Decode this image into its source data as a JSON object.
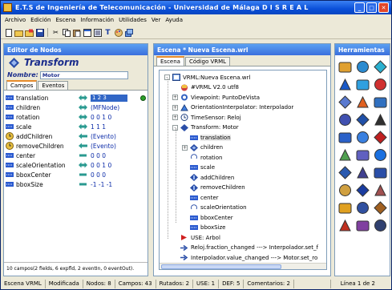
{
  "window": {
    "title": "E.T.S de Ingeniería de Telecomunicación - Universidad de Málaga    D I S R E A L"
  },
  "menu": [
    "Archivo",
    "Edición",
    "Escena",
    "Información",
    "Utilidades",
    "Ver",
    "Ayuda"
  ],
  "left_panel": {
    "header": "Editor de Nodos",
    "node_type": "Transform",
    "nombre_label": "Nombre:",
    "nombre_value": "Motor",
    "tabs": [
      "Campos",
      "Eventos"
    ],
    "fields": [
      {
        "name": "translation",
        "value": "1 2 3",
        "kind": "exposed",
        "selected": true
      },
      {
        "name": "children",
        "value": "(MFNode)",
        "kind": "exposed"
      },
      {
        "name": "rotation",
        "value": "0 0 1 0",
        "kind": "exposed"
      },
      {
        "name": "scale",
        "value": "1 1 1",
        "kind": "exposed"
      },
      {
        "name": "addChildren",
        "value": "(Evento)",
        "kind": "eventIn"
      },
      {
        "name": "removeChildren",
        "value": "(Evento)",
        "kind": "eventIn"
      },
      {
        "name": "center",
        "value": "0 0 0",
        "kind": "field"
      },
      {
        "name": "scaleOrientation",
        "value": "0 0 1 0",
        "kind": "exposed"
      },
      {
        "name": "bboxCenter",
        "value": "0 0 0",
        "kind": "field"
      },
      {
        "name": "bboxSize",
        "value": "-1 -1 -1",
        "kind": "field"
      }
    ],
    "status": "10 campos(2 fields, 6 expfld, 2 eventIn, 0 eventOut)."
  },
  "mid_panel": {
    "header": "Escena * Nueva Escena.wrl",
    "tabs": [
      "Escena",
      "Código VRML"
    ],
    "tree": [
      {
        "label": "VRML:Nueva Escena.wrl",
        "icon": "vrml-root-icon",
        "indent": 0,
        "expander": "-"
      },
      {
        "label": "#VRML V2.0 utf8",
        "icon": "header-icon",
        "indent": 1,
        "expander": ""
      },
      {
        "label": "Viewpoint: PuntoDeVista",
        "icon": "viewpoint-icon",
        "indent": 1,
        "expander": "+"
      },
      {
        "label": "OrientationInterpolator: Interpolador",
        "icon": "interpolator-icon",
        "indent": 1,
        "expander": "+"
      },
      {
        "label": "TimeSensor: Reloj",
        "icon": "timesensor-icon",
        "indent": 1,
        "expander": "+"
      },
      {
        "label": "Transform: Motor",
        "icon": "transform-icon",
        "indent": 1,
        "expander": "-"
      },
      {
        "label": "translation",
        "icon": "field-icon",
        "indent": 2,
        "expander": ""
      },
      {
        "label": "children",
        "icon": "children-icon",
        "indent": 2,
        "expander": "+"
      },
      {
        "label": "rotation",
        "icon": "rotation-icon",
        "indent": 2,
        "expander": ""
      },
      {
        "label": "scale",
        "icon": "field-icon",
        "indent": 2,
        "expander": ""
      },
      {
        "label": "addChildren",
        "icon": "event-icon",
        "indent": 2,
        "expander": ""
      },
      {
        "label": "removeChildren",
        "icon": "event-icon",
        "indent": 2,
        "expander": ""
      },
      {
        "label": "center",
        "icon": "field-icon",
        "indent": 2,
        "expander": ""
      },
      {
        "label": "scaleOrientation",
        "icon": "rotation-icon",
        "indent": 2,
        "expander": ""
      },
      {
        "label": "bboxCenter",
        "icon": "field-icon",
        "indent": 2,
        "expander": ""
      },
      {
        "label": "bboxSize",
        "icon": "field-icon",
        "indent": 2,
        "expander": ""
      },
      {
        "label": "USE: Arbol",
        "icon": "use-icon",
        "indent": 1,
        "expander": ""
      },
      {
        "label": "Reloj.fraction_changed ---> Interpolador.set_f",
        "icon": "route-icon",
        "indent": 1,
        "expander": ""
      },
      {
        "label": "Interpolador.value_changed ---> Motor.set_ro",
        "icon": "route-icon",
        "indent": 1,
        "expander": ""
      }
    ]
  },
  "right_panel": {
    "header": "Herramientas",
    "tools": [
      "folder-icon",
      "globe-icon",
      "sphere-icon",
      "blue-sphere-icon",
      "globe2-icon",
      "cylinder-icon",
      "cross-icon",
      "plane-icon",
      "connector-icon",
      "network-icon",
      "molecule-icon",
      "pen-icon",
      "arrows-icon",
      "star-icon",
      "red-box-icon",
      "move-icon",
      "shape-icon",
      "arrow-right-icon",
      "building-icon",
      "person-icon",
      "vrml-icon",
      "book-icon",
      "text-icon",
      "image-icon",
      "helmet-icon",
      "monitor-icon",
      "toolbox-icon",
      "house-icon",
      "music-icon",
      "table-icon"
    ]
  },
  "statusbar": {
    "escena": "Escena VRML",
    "modificada": "Modificada",
    "nodos": "Nodos: 8",
    "campos": "Campos: 43",
    "rutados": "Rutados: 2",
    "use": "USE: 1",
    "def": "DEF: 5",
    "comentarios": "Comentarios: 2",
    "linea": "Línea 1 de 2"
  }
}
